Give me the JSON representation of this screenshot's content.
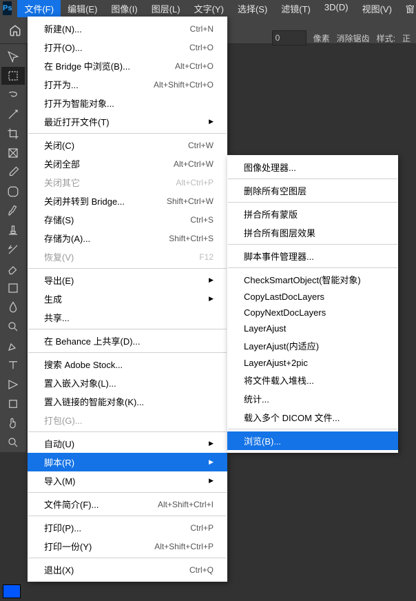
{
  "menubar": {
    "items": [
      "文件(F)",
      "编辑(E)",
      "图像(I)",
      "图层(L)",
      "文字(Y)",
      "选择(S)",
      "滤镜(T)",
      "3D(D)",
      "视图(V)",
      "窗"
    ]
  },
  "options": {
    "px_value": "0",
    "px_unit": "像素",
    "antialias": "消除锯齿",
    "style": "样式:",
    "normal": "正"
  },
  "file_menu": [
    {
      "label": "新建(N)...",
      "shortcut": "Ctrl+N"
    },
    {
      "label": "打开(O)...",
      "shortcut": "Ctrl+O"
    },
    {
      "label": "在 Bridge 中浏览(B)...",
      "shortcut": "Alt+Ctrl+O"
    },
    {
      "label": "打开为...",
      "shortcut": "Alt+Shift+Ctrl+O"
    },
    {
      "label": "打开为智能对象..."
    },
    {
      "label": "最近打开文件(T)",
      "submenu": true
    },
    {
      "sep": true
    },
    {
      "label": "关闭(C)",
      "shortcut": "Ctrl+W"
    },
    {
      "label": "关闭全部",
      "shortcut": "Alt+Ctrl+W"
    },
    {
      "label": "关闭其它",
      "shortcut": "Alt+Ctrl+P",
      "disabled": true
    },
    {
      "label": "关闭并转到 Bridge...",
      "shortcut": "Shift+Ctrl+W"
    },
    {
      "label": "存储(S)",
      "shortcut": "Ctrl+S"
    },
    {
      "label": "存储为(A)...",
      "shortcut": "Shift+Ctrl+S"
    },
    {
      "label": "恢复(V)",
      "shortcut": "F12",
      "disabled": true
    },
    {
      "sep": true
    },
    {
      "label": "导出(E)",
      "submenu": true
    },
    {
      "label": "生成",
      "submenu": true
    },
    {
      "label": "共享..."
    },
    {
      "sep": true
    },
    {
      "label": "在 Behance 上共享(D)..."
    },
    {
      "sep": true
    },
    {
      "label": "搜索 Adobe Stock..."
    },
    {
      "label": "置入嵌入对象(L)..."
    },
    {
      "label": "置入链接的智能对象(K)..."
    },
    {
      "label": "打包(G)...",
      "disabled": true
    },
    {
      "sep": true
    },
    {
      "label": "自动(U)",
      "submenu": true
    },
    {
      "label": "脚本(R)",
      "submenu": true,
      "highlight": true
    },
    {
      "label": "导入(M)",
      "submenu": true
    },
    {
      "sep": true
    },
    {
      "label": "文件简介(F)...",
      "shortcut": "Alt+Shift+Ctrl+I"
    },
    {
      "sep": true
    },
    {
      "label": "打印(P)...",
      "shortcut": "Ctrl+P"
    },
    {
      "label": "打印一份(Y)",
      "shortcut": "Alt+Shift+Ctrl+P"
    },
    {
      "sep": true
    },
    {
      "label": "退出(X)",
      "shortcut": "Ctrl+Q"
    }
  ],
  "script_submenu": [
    {
      "label": "图像处理器..."
    },
    {
      "sep": true
    },
    {
      "label": "删除所有空图层"
    },
    {
      "sep": true
    },
    {
      "label": "拼合所有蒙版"
    },
    {
      "label": "拼合所有图层效果"
    },
    {
      "sep": true
    },
    {
      "label": "脚本事件管理器..."
    },
    {
      "sep": true
    },
    {
      "label": "CheckSmartObject(智能对象)"
    },
    {
      "label": "CopyLastDocLayers"
    },
    {
      "label": "CopyNextDocLayers"
    },
    {
      "label": "LayerAjust"
    },
    {
      "label": "LayerAjust(内适应)"
    },
    {
      "label": "LayerAjust+2pic"
    },
    {
      "label": "将文件载入堆栈..."
    },
    {
      "label": "统计..."
    },
    {
      "label": "载入多个 DICOM 文件..."
    },
    {
      "sep": true
    },
    {
      "label": "浏览(B)...",
      "highlight": true
    }
  ],
  "tools": [
    "move",
    "marquee",
    "lasso",
    "wand",
    "crop",
    "frame",
    "eyedrop",
    "patch",
    "brush",
    "stamp",
    "history",
    "eraser",
    "gradient",
    "blur",
    "dodge",
    "pen",
    "type",
    "path",
    "rect",
    "hand",
    "zoom"
  ]
}
